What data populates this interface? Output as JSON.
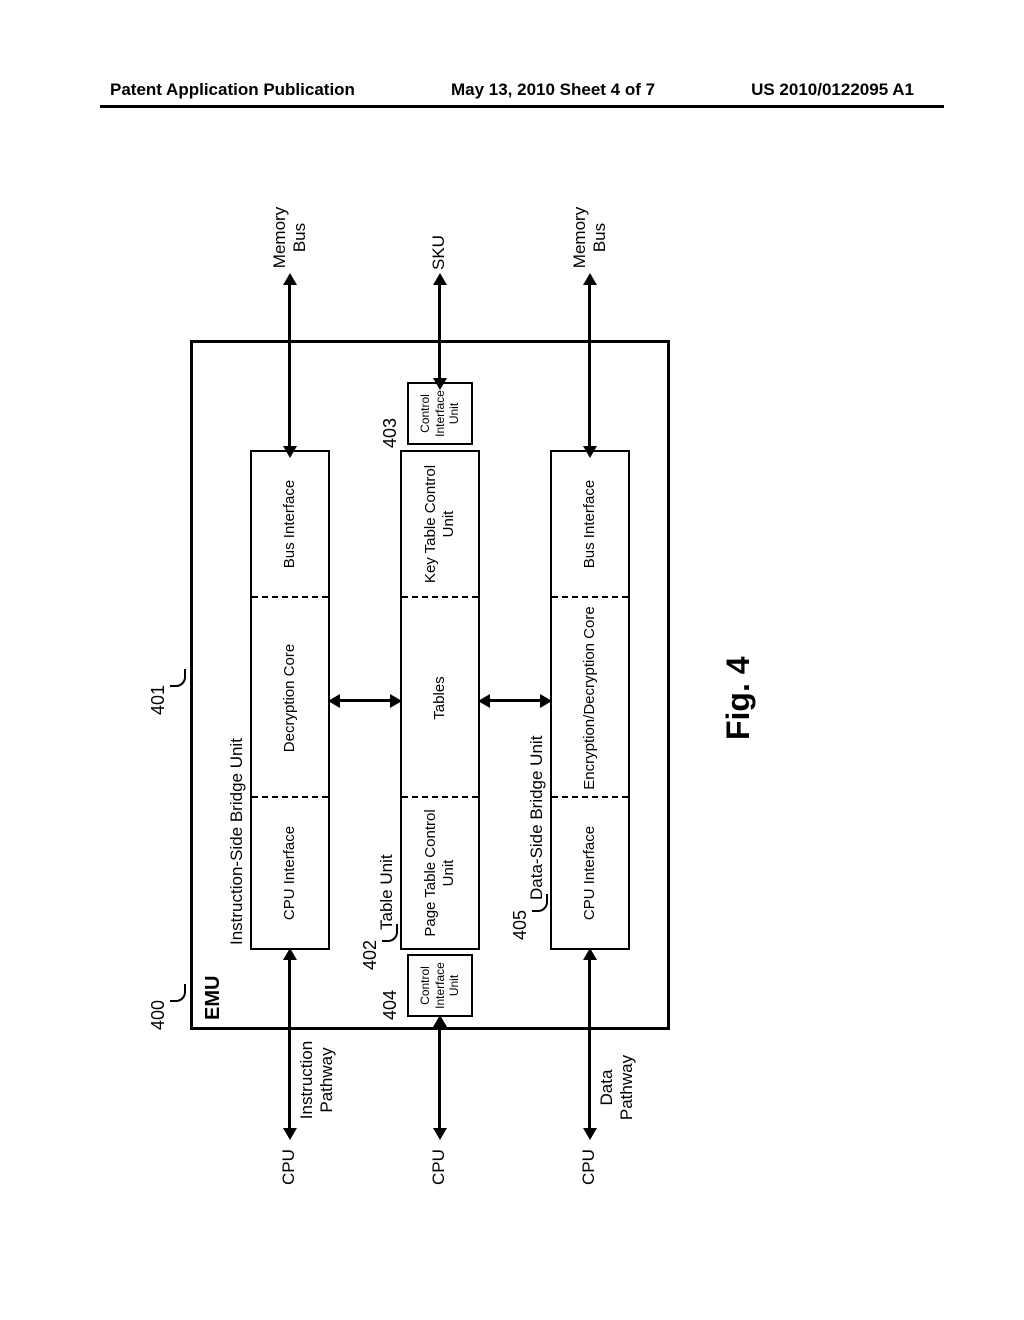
{
  "header": {
    "left": "Patent Application Publication",
    "center": "May 13, 2010  Sheet 4 of 7",
    "right": "US 2010/0122095 A1"
  },
  "refs": {
    "r400": "400",
    "r401": "401",
    "r402": "402",
    "r403": "403",
    "r404": "404",
    "r405": "405"
  },
  "labels": {
    "emu": "EMU",
    "isbu_title": "Instruction-Side Bridge Unit",
    "dsbu_title": "Data-Side Bridge Unit",
    "table_unit_title": "Table Unit",
    "cpu_interface": "CPU Interface",
    "decryption_core": "Decryption Core",
    "bus_interface": "Bus Interface",
    "enc_dec_core": "Encryption/Decryption Core",
    "page_table_cu": "Page Table Control Unit",
    "tables": "Tables",
    "key_table_cu": "Key Table Control Unit",
    "control_iu": "Control Interface Unit",
    "cpu": "CPU",
    "instruction_pathway": "Instruction Pathway",
    "data_pathway": "Data Pathway",
    "memory_bus": "Memory Bus",
    "sku": "SKU",
    "fig": "Fig. 4"
  }
}
